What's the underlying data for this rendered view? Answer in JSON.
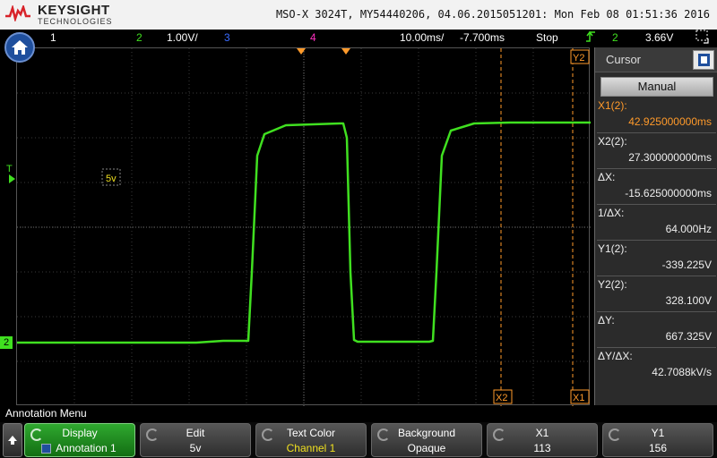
{
  "header": {
    "brand": "KEYSIGHT",
    "brand_sub": "TECHNOLOGIES",
    "title": "MSO-X 3024T, MY54440206, 04.06.2015051201: Mon Feb 08 01:51:36 2016"
  },
  "status": {
    "ch1": "1",
    "ch2": "2",
    "ch2_scale": "1.00V/",
    "ch3": "3",
    "ch4": "4",
    "timebase": "10.00ms/",
    "delay": "-7.700ms",
    "run_state": "Stop",
    "trigger_source": "2",
    "trigger_level": "3.66V"
  },
  "plot": {
    "ground_marker": "2",
    "trigger_marker": "T",
    "annotation_text": "5v",
    "cursor_labels": {
      "x1": "X1",
      "x2": "X2",
      "y2": "Y2"
    }
  },
  "cursor_panel": {
    "title": "Cursor",
    "mode": "Manual",
    "rows": [
      {
        "label": "X1(2):",
        "value": "42.925000000ms",
        "highlight": true
      },
      {
        "label": "X2(2):",
        "value": "27.300000000ms",
        "highlight": false
      },
      {
        "label": "ΔX:",
        "value": "-15.625000000ms",
        "highlight": false
      },
      {
        "label": "1/ΔX:",
        "value": "64.000Hz",
        "highlight": false
      },
      {
        "label": "Y1(2):",
        "value": "-339.225V",
        "highlight": false
      },
      {
        "label": "Y2(2):",
        "value": "328.100V",
        "highlight": false
      },
      {
        "label": "ΔY:",
        "value": "667.325V",
        "highlight": false
      },
      {
        "label": "ΔY/ΔX:",
        "value": "42.7088kV/s",
        "highlight": false
      }
    ]
  },
  "menu": {
    "title": "Annotation Menu",
    "softkeys": [
      {
        "label": "Display",
        "value": "Annotation 1"
      },
      {
        "label": "Edit",
        "value": "5v"
      },
      {
        "label": "Text Color",
        "value": "Channel 1"
      },
      {
        "label": "Background",
        "value": "Opaque"
      },
      {
        "label": "X1",
        "value": "113"
      },
      {
        "label": "Y1",
        "value": "156"
      }
    ]
  },
  "colors": {
    "ch1": "#f0e020",
    "ch2": "#40e020",
    "ch3": "#3060ff",
    "ch4": "#ff30c0",
    "cursor_x1": "#ff9a2a",
    "cursor_x2": "#ff9a2a",
    "softkey_active": "#1a8a1a"
  },
  "icons": {
    "home": "home-icon",
    "back": "up-arrow-icon",
    "close": "close-panel-icon",
    "knob": "rotate-knob-icon",
    "run_trigger": "rising-edge-trigger-icon"
  }
}
